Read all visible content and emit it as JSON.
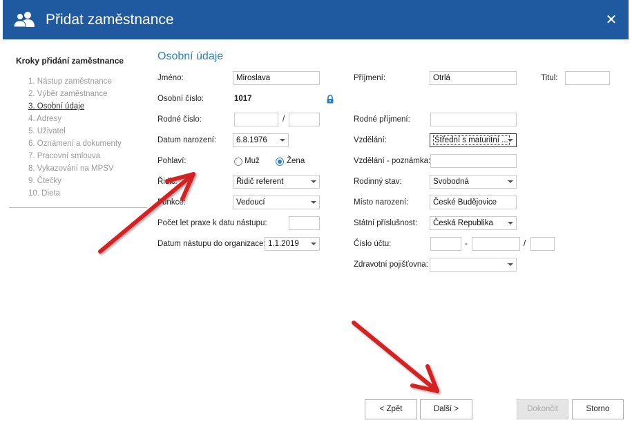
{
  "window": {
    "title": "Přidat zaměstnance",
    "close_glyph": "✕",
    "title_icon": "users-icon",
    "close_icon": "close-icon"
  },
  "sidebar": {
    "title": "Kroky přidání zaměstnance",
    "steps": [
      {
        "label": "1. Nástup zaměstnance",
        "active": false
      },
      {
        "label": "2. Výběr zaměstnance",
        "active": false
      },
      {
        "label": "3. Osobní údaje",
        "active": true
      },
      {
        "label": "4. Adresy",
        "active": false
      },
      {
        "label": "5. Uživatel",
        "active": false
      },
      {
        "label": "6. Oznámení a dokumenty",
        "active": false
      },
      {
        "label": "7. Pracovní smlouva",
        "active": false
      },
      {
        "label": "8. Vykazování na MPSV",
        "active": false
      },
      {
        "label": "9. Čtečky",
        "active": false
      },
      {
        "label": "10. Dieta",
        "active": false
      }
    ]
  },
  "form": {
    "section_title": "Osobní údaje",
    "left": {
      "jmeno_label": "Jméno:",
      "jmeno_value": "Miroslava",
      "osobni_cislo_label": "Osobní číslo:",
      "osobni_cislo_value": "1017",
      "rodne_cislo_label": "Rodné číslo:",
      "rodne_cislo_sep": "/",
      "datum_narozeni_label": "Datum narození:",
      "datum_narozeni_value": "6.8.1976",
      "pohlavi_label": "Pohlaví:",
      "pohlavi_muz": "Muž",
      "pohlavi_zena": "Žena",
      "pohlavi_selected": "Žena",
      "ridic_label": "Řidič:",
      "ridic_value": "Řidič referent",
      "funkce_label": "Funkce:",
      "funkce_value": "Vedoucí",
      "praxe_label": "Počet let praxe k datu nástupu:",
      "datum_nastupu_label": "Datum nástupu do organizace:",
      "datum_nastupu_value": "1.1.2019"
    },
    "right": {
      "prijmeni_label": "Příjmení:",
      "prijmeni_value": "Otrlá",
      "titul_label": "Titul:",
      "rodne_prijmeni_label": "Rodné příjmení:",
      "vzdelani_label": "Vzdělání:",
      "vzdelani_value": "Střední s maturitní ...",
      "vzdelani_poznamka_label": "Vzdělání - poznámka:",
      "rodinny_stav_label": "Rodinný stav:",
      "rodinny_stav_value": "Svobodná",
      "misto_narozeni_label": "Místo narození:",
      "misto_narozeni_value": "České Budějovice",
      "statni_prislusnost_label": "Státní příslušnost:",
      "statni_prislusnost_value": "Česká Republika",
      "cislo_uctu_label": "Číslo účtu:",
      "cislo_uctu_sep1": "-",
      "cislo_uctu_sep2": "/",
      "zdravotni_pojistovna_label": "Zdravotní pojišťovna:"
    }
  },
  "footer": {
    "back_label": "< Zpět",
    "next_label": "Další >",
    "finish_label": "Dokončit",
    "cancel_label": "Storno"
  },
  "colors": {
    "titlebar": "#1f5aa0",
    "accent": "#2a7fc4",
    "annotation_arrow": "#d42020"
  }
}
